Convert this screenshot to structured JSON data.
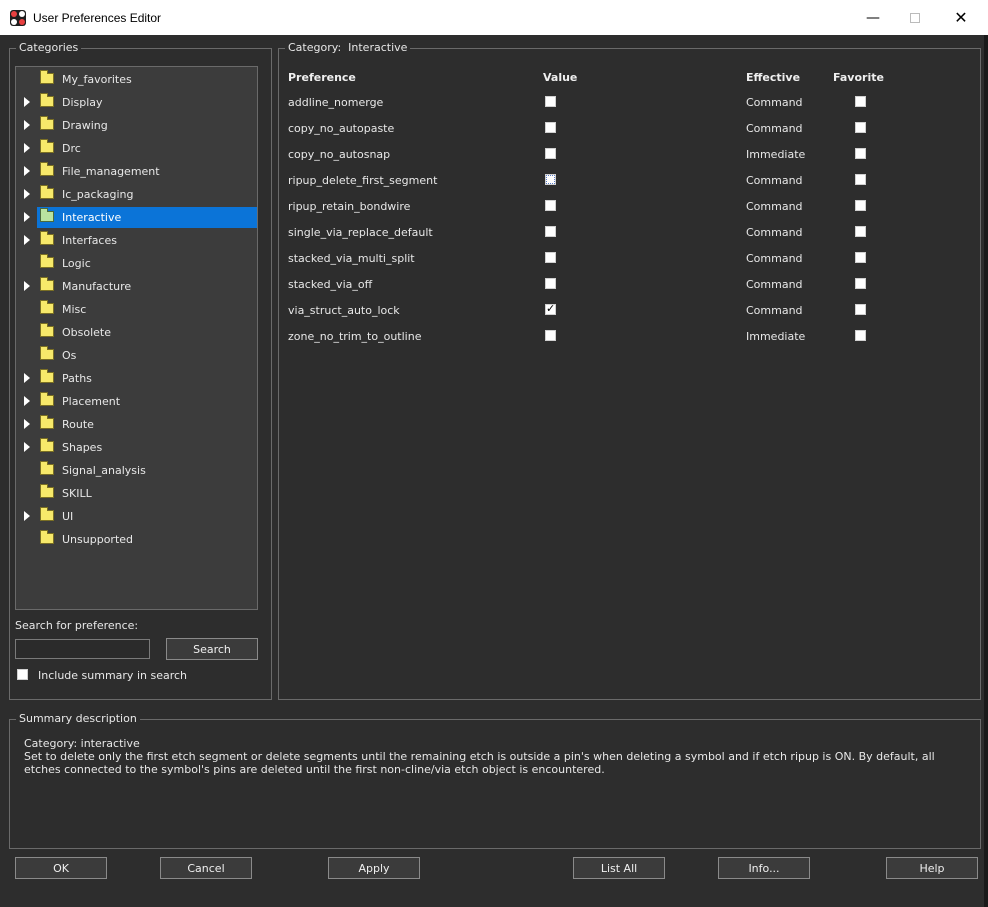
{
  "window": {
    "title": "User Preferences Editor"
  },
  "categories": {
    "label": "Categories",
    "items": [
      {
        "label": "My_favorites",
        "expandable": false
      },
      {
        "label": "Display",
        "expandable": true
      },
      {
        "label": "Drawing",
        "expandable": true
      },
      {
        "label": "Drc",
        "expandable": true
      },
      {
        "label": "File_management",
        "expandable": true
      },
      {
        "label": "Ic_packaging",
        "expandable": true
      },
      {
        "label": "Interactive",
        "expandable": true,
        "selected": true
      },
      {
        "label": "Interfaces",
        "expandable": true
      },
      {
        "label": "Logic",
        "expandable": false
      },
      {
        "label": "Manufacture",
        "expandable": true
      },
      {
        "label": "Misc",
        "expandable": false
      },
      {
        "label": "Obsolete",
        "expandable": false
      },
      {
        "label": "Os",
        "expandable": false
      },
      {
        "label": "Paths",
        "expandable": true
      },
      {
        "label": "Placement",
        "expandable": true
      },
      {
        "label": "Route",
        "expandable": true
      },
      {
        "label": "Shapes",
        "expandable": true
      },
      {
        "label": "Signal_analysis",
        "expandable": false
      },
      {
        "label": "SKILL",
        "expandable": false
      },
      {
        "label": "UI",
        "expandable": true
      },
      {
        "label": "Unsupported",
        "expandable": false
      }
    ]
  },
  "search": {
    "label": "Search for preference:",
    "value": "",
    "button": "Search",
    "include_summary_label": "Include summary in search",
    "include_summary_checked": false
  },
  "category_panel": {
    "label": "Category:",
    "name": "Interactive",
    "columns": {
      "preference": "Preference",
      "value": "Value",
      "effective": "Effective",
      "favorite": "Favorite"
    },
    "rows": [
      {
        "name": "addline_nomerge",
        "value": false,
        "effective": "Command",
        "favorite": false
      },
      {
        "name": "copy_no_autopaste",
        "value": false,
        "effective": "Command",
        "favorite": false
      },
      {
        "name": "copy_no_autosnap",
        "value": false,
        "effective": "Immediate",
        "favorite": false
      },
      {
        "name": "ripup_delete_first_segment",
        "value": false,
        "effective": "Command",
        "favorite": false,
        "focused": true
      },
      {
        "name": "ripup_retain_bondwire",
        "value": false,
        "effective": "Command",
        "favorite": false
      },
      {
        "name": "single_via_replace_default",
        "value": false,
        "effective": "Command",
        "favorite": false
      },
      {
        "name": "stacked_via_multi_split",
        "value": false,
        "effective": "Command",
        "favorite": false
      },
      {
        "name": "stacked_via_off",
        "value": false,
        "effective": "Command",
        "favorite": false
      },
      {
        "name": "via_struct_auto_lock",
        "value": true,
        "effective": "Command",
        "favorite": false
      },
      {
        "name": "zone_no_trim_to_outline",
        "value": false,
        "effective": "Immediate",
        "favorite": false
      }
    ]
  },
  "summary": {
    "label": "Summary description",
    "category_line": "Category: interactive",
    "text": "Set to delete only the first etch segment or delete segments until the remaining etch is outside a pin's when deleting a symbol and if etch ripup is ON. By default, all etches connected to the symbol's pins are deleted until the first non-cline/via etch object is encountered."
  },
  "buttons": {
    "ok": "OK",
    "cancel": "Cancel",
    "apply": "Apply",
    "list_all": "List All",
    "info": "Info...",
    "help": "Help"
  },
  "colors": {
    "selection": "#0b74d8",
    "background": "#2d2d2d",
    "tree_background": "#3c3c3c"
  },
  "icons": [
    "app-icon",
    "folder-icon",
    "expand-arrow-icon",
    "checkbox-icon",
    "minimize-icon",
    "maximize-icon",
    "close-icon"
  ]
}
